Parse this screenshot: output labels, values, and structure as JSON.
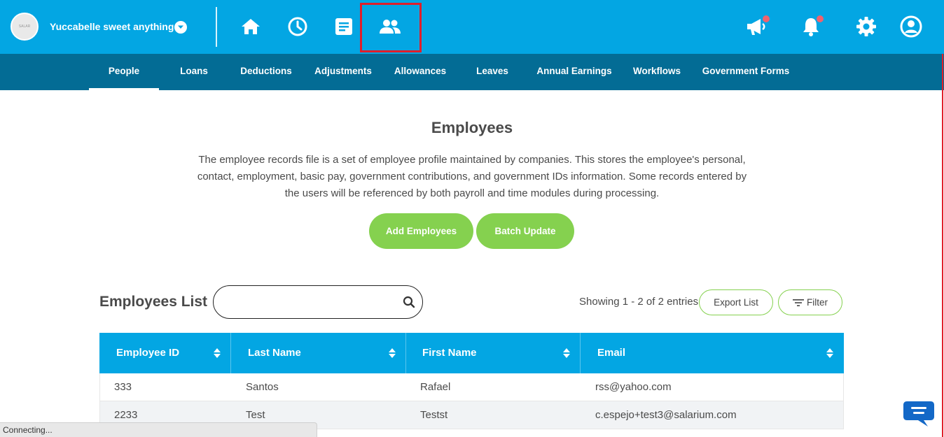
{
  "header": {
    "company_name": "Yuccabelle sweet anything",
    "avatar_text": "SALAR"
  },
  "subnav": {
    "items": [
      {
        "label": "People"
      },
      {
        "label": "Loans"
      },
      {
        "label": "Deductions"
      },
      {
        "label": "Adjustments"
      },
      {
        "label": "Allowances"
      },
      {
        "label": "Leaves"
      },
      {
        "label": "Annual Earnings"
      },
      {
        "label": "Workflows"
      },
      {
        "label": "Government Forms"
      }
    ],
    "active": "People"
  },
  "main": {
    "title": "Employees",
    "description": "The employee records file is a set of employee profile maintained by companies. This stores the employee's personal, contact, employment, basic pay, government contributions, and government IDs information. Some records entered by the users will be referenced by both payroll and time modules during processing.",
    "add_button": "Add Employees",
    "batch_button": "Batch Update"
  },
  "list": {
    "title": "Employees List",
    "search_placeholder": "",
    "showing": "Showing 1 - 2 of 2 entries",
    "export_button": "Export List",
    "filter_button": "Filter",
    "columns": [
      "Employee ID",
      "Last Name",
      "First Name",
      "Email"
    ],
    "rows": [
      [
        "333",
        "Santos",
        "Rafael",
        "rss@yahoo.com"
      ],
      [
        "2233",
        "Test",
        "Testst",
        "c.espejo+test3@salarium.com"
      ]
    ]
  },
  "status_bar": "Connecting...",
  "icons": [
    "home-icon",
    "clock-icon",
    "document-icon",
    "people-icon",
    "megaphone-icon",
    "bell-icon",
    "gear-icon",
    "user-icon",
    "search-icon",
    "filter-icon",
    "chat-icon"
  ],
  "colors": {
    "topbar": "#03a6e3",
    "subnav": "#036c95",
    "accent_green": "#85d14f",
    "highlight_red": "#e01e2a",
    "notification_dot": "#f0626e"
  }
}
